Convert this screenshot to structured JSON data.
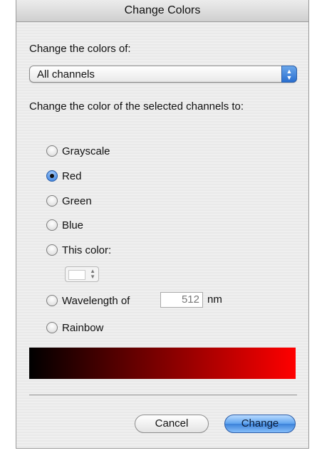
{
  "dialog": {
    "title": "Change Colors"
  },
  "change_of": {
    "label": "Change the colors of:",
    "selected": "All channels"
  },
  "target": {
    "label": "Change the color of the selected channels to:",
    "options": [
      {
        "label": "Grayscale",
        "selected": false
      },
      {
        "label": "Red",
        "selected": true
      },
      {
        "label": "Green",
        "selected": false
      },
      {
        "label": "Blue",
        "selected": false
      },
      {
        "label": "This color:",
        "selected": false
      },
      {
        "label": "Wavelength of",
        "selected": false
      },
      {
        "label": "Rainbow",
        "selected": false
      }
    ]
  },
  "this_color": {
    "swatch": "#ffffff"
  },
  "wavelength": {
    "value": "512",
    "unit": "nm"
  },
  "preview": {
    "from": "#000000",
    "to": "#ff0000"
  },
  "buttons": {
    "cancel": "Cancel",
    "change": "Change"
  }
}
